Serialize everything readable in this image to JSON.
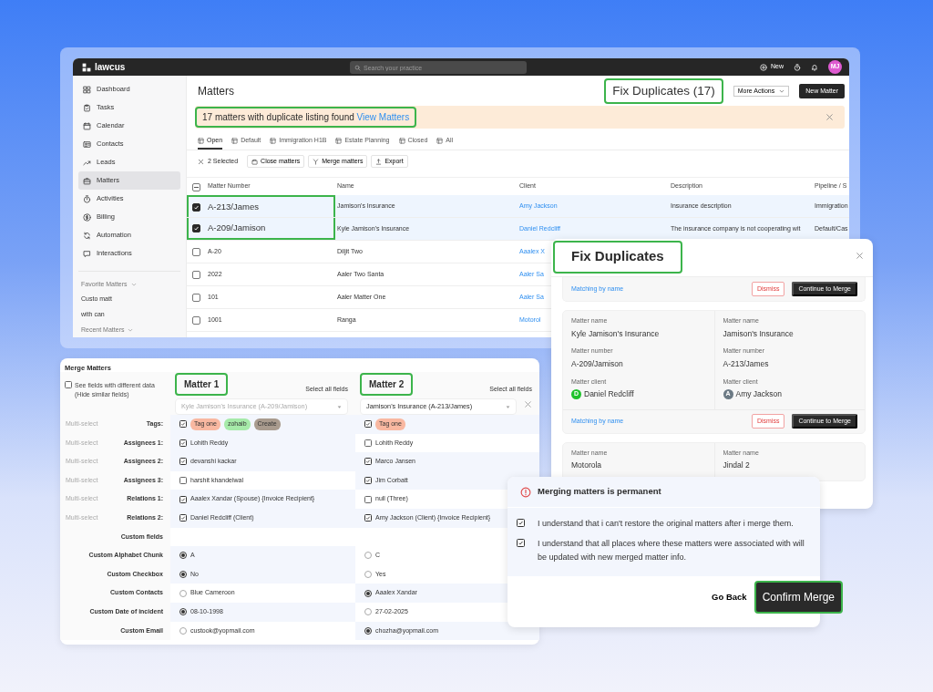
{
  "app": {
    "logo": "lawcus",
    "search": {
      "placeholder": "Search your practice"
    },
    "new_label": "New",
    "avatar": "MJ",
    "sidebar": {
      "items": [
        {
          "label": "Dashboard",
          "selected": false
        },
        {
          "label": "Tasks",
          "selected": false
        },
        {
          "label": "Calendar",
          "selected": false
        },
        {
          "label": "Contacts",
          "selected": false
        },
        {
          "label": "Leads",
          "selected": false
        },
        {
          "label": "Matters",
          "selected": true
        },
        {
          "label": "Activities",
          "selected": false
        },
        {
          "label": "Billing",
          "selected": false
        },
        {
          "label": "Automation",
          "selected": false
        },
        {
          "label": "Interactions",
          "selected": false
        }
      ],
      "sections": [
        {
          "title": "Favorite Matters",
          "items": [
            "Custo matt",
            "with can"
          ]
        },
        {
          "title": "Recent Matters"
        }
      ]
    },
    "page_title": "Matters",
    "header_buttons": [
      {
        "label": "Fix Duplicates (17)",
        "kind": "text",
        "highlighted": true
      },
      {
        "label": "More Actions",
        "kind": "dropdown",
        "highlighted": false
      },
      {
        "label": "New Matter",
        "kind": "dark",
        "highlighted": false
      }
    ],
    "alert": {
      "text": "17 matters with duplicate listing found",
      "link": "View Matters",
      "highlighted": true
    },
    "tabs": [
      {
        "label": "Open",
        "selected": true
      },
      {
        "label": "Default",
        "selected": false
      },
      {
        "label": "Immigration H1B",
        "selected": false
      },
      {
        "label": "Estate Planning",
        "selected": false
      },
      {
        "label": "Closed",
        "selected": false
      },
      {
        "label": "All",
        "selected": false
      }
    ],
    "toolbar": {
      "selection": "2 Selected",
      "buttons": [
        "Close matters",
        "Merge matters",
        "Export"
      ]
    },
    "table": {
      "header_checkbox": {
        "indeterminate": true
      },
      "columns": [
        {
          "label": "Matter Number",
          "kind": "text"
        },
        {
          "label": "Name",
          "kind": "text"
        },
        {
          "label": "Client",
          "kind": "link"
        },
        {
          "label": "Description",
          "kind": "text"
        },
        {
          "label": "Pipeline / S",
          "kind": "text"
        }
      ],
      "rows": [
        {
          "checked": true,
          "highlighted": true,
          "cells": [
            "A-213/James",
            "Jamison's Insurance",
            "Amy Jackson",
            "Insurance description",
            "Immigration"
          ]
        },
        {
          "checked": true,
          "highlighted": true,
          "cells": [
            "A-209/Jamison",
            "Kyle Jamison's Insurance",
            "Daniel Redcliff",
            "The insurance company is not cooperating wit",
            "Default/Cas"
          ]
        },
        {
          "checked": false,
          "highlighted": false,
          "cells": [
            "A-20",
            "Diljit Two",
            "Aaalex X"
          ]
        },
        {
          "checked": false,
          "highlighted": false,
          "cells": [
            "2022",
            "Aaler Two Santa",
            "Aaler Sa"
          ]
        },
        {
          "checked": false,
          "highlighted": false,
          "cells": [
            "101",
            "Aaler Matter One",
            "Aaler Sa"
          ]
        },
        {
          "checked": false,
          "highlighted": false,
          "cells": [
            "1001",
            "Ranga",
            "Motorol"
          ]
        }
      ]
    }
  },
  "fix_duplicates": {
    "title": "Fix Duplicates",
    "highlighted": true,
    "groups": [
      {
        "footer": {
          "match": "Matching by name",
          "dismiss": "Dismiss",
          "merge": "Continue to Merge"
        }
      },
      {
        "matters": [
          {
            "fields": [
              {
                "label": "Matter name",
                "value": "Kyle Jamison's Insurance"
              },
              {
                "label": "Matter number",
                "value": "A-209/Jamison"
              },
              {
                "label": "Matter client",
                "value": "Daniel Redcliff",
                "avatar": "D",
                "color": "#1fc22c"
              }
            ]
          },
          {
            "fields": [
              {
                "label": "Matter name",
                "value": "Jamison's Insurance"
              },
              {
                "label": "Matter number",
                "value": "A-213/James"
              },
              {
                "label": "Matter client",
                "value": "Amy Jackson",
                "avatar": "A",
                "color": "#6c7a85"
              }
            ]
          }
        ],
        "footer": {
          "match": "Matching by name",
          "dismiss": "Dismiss",
          "merge": "Continue to Merge"
        }
      },
      {
        "matters": [
          {
            "fields": [
              {
                "label": "Matter name",
                "value": "Motorola"
              }
            ]
          },
          {
            "fields": [
              {
                "label": "Matter name",
                "value": "Jindal 2"
              }
            ]
          }
        ]
      }
    ]
  },
  "merge_matters": {
    "title": "Merge Matters",
    "filter": {
      "label": "See fields with different data (Hide similar fields)",
      "checked": false
    },
    "matters": [
      {
        "heading": "Matter 1",
        "highlighted": true,
        "select_all": "Select all fields",
        "value": "Kyle Jamison's Insurance (A-209/Jamison)",
        "disabled": true,
        "clearable": false
      },
      {
        "heading": "Matter 2",
        "highlighted": true,
        "select_all": "Select all fields",
        "value": "Jamison's Insurance (A-213/James)",
        "disabled": false,
        "clearable": true
      }
    ],
    "rows": [
      {
        "type": "Multi-select",
        "label": "Tags:",
        "kind": "check",
        "cells": [
          {
            "checked": true,
            "tags": [
              {
                "label": "Tag one",
                "color": "#f9b8a1"
              },
              {
                "label": "zohaib",
                "color": "#a6eaa9"
              },
              {
                "label": "Create",
                "color": "#a99b8e"
              }
            ]
          },
          {
            "checked": true,
            "tags": [
              {
                "label": "Tag one",
                "color": "#f9b8a1"
              }
            ]
          }
        ]
      },
      {
        "type": "Multi-select",
        "label": "Assignees 1:",
        "kind": "check",
        "cells": [
          {
            "checked": true,
            "value": "Lohith Reddy"
          },
          {
            "checked": false,
            "value": "Lohith Reddy"
          }
        ]
      },
      {
        "type": "Multi-select",
        "label": "Assignees 2:",
        "kind": "check",
        "cells": [
          {
            "checked": true,
            "value": "devanshi kackar"
          },
          {
            "checked": true,
            "value": "Marco Jansen"
          }
        ]
      },
      {
        "type": "Multi-select",
        "label": "Assignees 3:",
        "kind": "check",
        "cells": [
          {
            "checked": false,
            "value": "harshit khandelwal"
          },
          {
            "checked": true,
            "value": "Jim Corbatt"
          }
        ]
      },
      {
        "type": "Multi-select",
        "label": "Relations 1:",
        "kind": "check",
        "cells": [
          {
            "checked": true,
            "value": "Aaalex Xandar (Spouse) {Invoice Recipient}"
          },
          {
            "checked": false,
            "value": "null (Three)"
          }
        ]
      },
      {
        "type": "Multi-select",
        "label": "Relations 2:",
        "kind": "check",
        "cells": [
          {
            "checked": true,
            "value": "Daniel Redcliff (Client)"
          },
          {
            "checked": true,
            "value": "Amy Jackson (Client) {Invoice Recipient}"
          }
        ]
      },
      {
        "label": "Custom fields",
        "kind": "section"
      },
      {
        "label": "Custom Alphabet Chunk",
        "kind": "radio",
        "cells": [
          {
            "selected": true,
            "value": "A"
          },
          {
            "selected": false,
            "value": "C"
          }
        ]
      },
      {
        "label": "Custom Checkbox",
        "kind": "radio",
        "cells": [
          {
            "selected": true,
            "value": "No"
          },
          {
            "selected": false,
            "value": "Yes"
          }
        ]
      },
      {
        "label": "Custom Contacts",
        "kind": "radio",
        "cells": [
          {
            "selected": false,
            "value": "Blue Cameroon"
          },
          {
            "selected": true,
            "value": "Aaalex Xandar"
          }
        ]
      },
      {
        "label": "Custom Date of incident",
        "kind": "radio",
        "cells": [
          {
            "selected": true,
            "value": "08-10-1998"
          },
          {
            "selected": false,
            "value": "27-02-2025"
          }
        ]
      },
      {
        "label": "Custom Email",
        "kind": "radio",
        "cells": [
          {
            "selected": false,
            "value": "custook@yopmail.com"
          },
          {
            "selected": true,
            "value": "chozha@yopmail.com"
          }
        ]
      }
    ]
  },
  "confirm": {
    "title": "Merging matters is permanent",
    "items": [
      {
        "text": "I understand that i can't restore the original matters after i merge them.",
        "checked": true
      },
      {
        "text": "I understand that all places where these matters were associated with will be updated with new merged matter info.",
        "checked": true
      }
    ],
    "cancel": "Go Back",
    "confirm": {
      "label": "Confirm Merge",
      "highlighted": true
    }
  }
}
